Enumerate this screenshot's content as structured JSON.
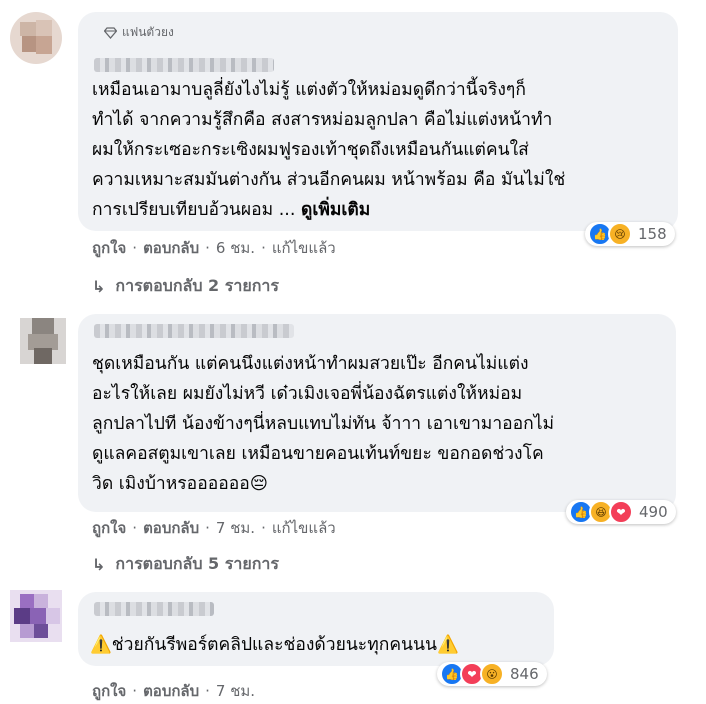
{
  "comments": [
    {
      "badge": "แฟนตัวยง",
      "text": "เหมือนเอามาบลูลี่ยังไงไม่รู้ แต่งตัวให้หม่อมดูดีกว่านี้จริงๆก็\nทำได้ จากความรู้สึกคือ สงสารหม่อมลูกปลา คือไม่แต่งหน้าทำ\nผมให้กระเซอะกระเซิงผมฟูรองเท้าชุดถึงเหมือนกันแต่คนใส่\nความเหมาะสมมันต่างกัน ส่วนอีกคนผม หน้าพร้อม คือ มันไม่ใช่\nการเปรียบเทียบอ้วนผอม ... ",
      "see_more": "ดูเพิ่มเติม",
      "reaction_count": "158",
      "like": "ถูกใจ",
      "reply": "ตอบกลับ",
      "time": "6 ชม.",
      "edited": "แก้ไขแล้ว",
      "replies_label": "การตอบกลับ 2 รายการ"
    },
    {
      "text": "ชุดเหมือนกัน แต่คนนึงแต่งหน้าทำผมสวยเป๊ะ อีกคนไม่แต่ง\nอะไรให้เลย ผมยังไม่หวี เด๋วเมิงเจอพี่น้องฉัตรแต่งให้หม่อม\nลูกปลาไปที น้องข้างๆนี่หลบแทบไม่ทัน จ้าาา เอาเขามาออกไม่\nดูแลคอสตูมเขาเลย เหมือนขายคอนเท้นท์ขยะ ขอกอดช่วงโค\nวิด เมิงบ้าหรออออออ😔",
      "reaction_count": "490",
      "like": "ถูกใจ",
      "reply": "ตอบกลับ",
      "time": "7 ชม.",
      "edited": "แก้ไขแล้ว",
      "replies_label": "การตอบกลับ 5 รายการ"
    },
    {
      "warn_icon": "⚠️",
      "text": "ช่วยกันรีพอร์ตคลิปและช่องด้วยนะทุกคนนน",
      "reaction_count": "846",
      "like": "ถูกใจ",
      "reply": "ตอบกลับ",
      "time": "7 ชม."
    }
  ],
  "separator": "·",
  "reply_arrow": "↳",
  "colors": {
    "bubble": "#f0f2f5",
    "secondary": "#65676b",
    "like": "#1877f2",
    "love": "#f33e58",
    "emoji": "#f7b125"
  }
}
